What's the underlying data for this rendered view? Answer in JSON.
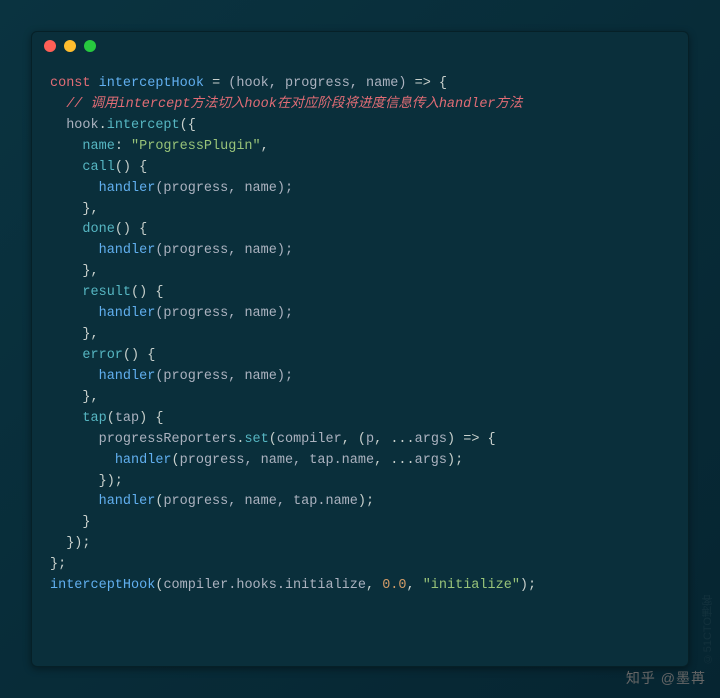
{
  "code": {
    "l01_const": "const",
    "l01_name": "interceptHook",
    "l01_params": "(hook, progress, name)",
    "l01_arrow": " => {",
    "l02_comment": "// 调用intercept方法切入hook在对应阶段将进度信息传入handler方法",
    "l03_hook": "hook",
    "l03_int": "intercept",
    "l04_nameKey": "name",
    "l04_nameVal": "\"ProgressPlugin\"",
    "l05_call": "call",
    "l06_handler": "handler",
    "l06_args": "(progress, name);",
    "l08_done": "done",
    "l11_result": "result",
    "l14_error": "error",
    "l17_tap": "tap",
    "l17_tapArg": "tap",
    "l18_pr": "progressReporters",
    "l18_set": "set",
    "l18_compiler": "compiler",
    "l18_p": "p",
    "l18_args": "args",
    "l19_tapname": "tap.name",
    "l19_argsSpread": "args",
    "l25_call": "interceptHook",
    "l25_hooks": "compiler.hooks.initialize",
    "l25_num": "0.0",
    "l25_str": "\"initialize\""
  },
  "credit": "知乎 @墨苒",
  "watermark": "©51CTO博客"
}
